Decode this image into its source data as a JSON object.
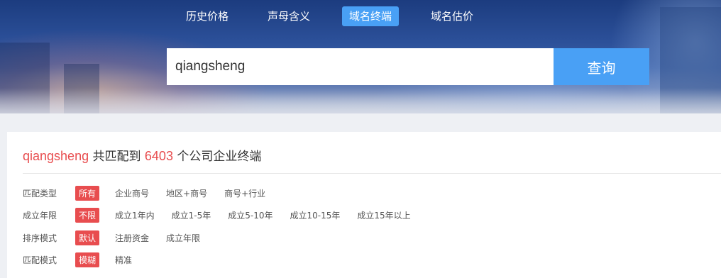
{
  "nav": {
    "items": [
      {
        "label": "历史价格",
        "active": false
      },
      {
        "label": "声母含义",
        "active": false
      },
      {
        "label": "域名终端",
        "active": true
      },
      {
        "label": "域名估价",
        "active": false
      }
    ]
  },
  "search": {
    "value": "qiangsheng",
    "button_label": "查询"
  },
  "summary": {
    "keyword": "qiangsheng",
    "text_before": " 共匹配到 ",
    "count": "6403",
    "text_after": " 个公司企业终端"
  },
  "filters": [
    {
      "label": "匹配类型",
      "options": [
        "所有",
        "企业商号",
        "地区+商号",
        "商号+行业"
      ],
      "selected": 0
    },
    {
      "label": "成立年限",
      "options": [
        "不限",
        "成立1年内",
        "成立1-5年",
        "成立5-10年",
        "成立10-15年",
        "成立15年以上"
      ],
      "selected": 0
    },
    {
      "label": "排序模式",
      "options": [
        "默认",
        "注册资金",
        "成立年限"
      ],
      "selected": 0
    },
    {
      "label": "匹配模式",
      "options": [
        "模糊",
        "精准"
      ],
      "selected": 0
    }
  ],
  "colors": {
    "accent_blue": "#49a0f5",
    "accent_red": "#e84d4f",
    "banner_dark": "#1c3c7f"
  }
}
